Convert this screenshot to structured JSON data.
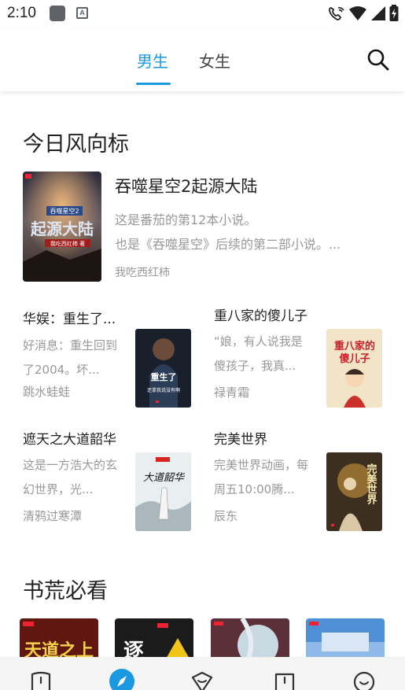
{
  "status": {
    "time": "2:10"
  },
  "tabs": {
    "male": "男生",
    "female": "女生"
  },
  "section1": {
    "title": "今日风向标"
  },
  "featured": {
    "title": "吞噬星空2起源大陆",
    "desc_line1": "这是番茄的第12本小说。",
    "desc_line2": "也是《吞噬星空》后续的第二部小说。...",
    "author": "我吃西红柿"
  },
  "books": [
    {
      "title": "华娱：重生了...",
      "desc": "好消息：重生回到了2004。坏...",
      "author": "跳水蛙蛙"
    },
    {
      "title": "重八家的傻儿子",
      "desc": "“娘，有人说我是傻孩子，我真...",
      "author": "禄青霜"
    },
    {
      "title": "遮天之大道韶华",
      "desc": "这是一方浩大的玄幻世界，光...",
      "author": "清鸦过寒潭"
    },
    {
      "title": "完美世界",
      "desc": "完美世界动画，每周五10:00腾...",
      "author": "辰东"
    }
  ],
  "section2": {
    "title": "书荒必看"
  },
  "colors": {
    "accent": "#1a98e0",
    "muted": "#999999"
  },
  "icons": [
    "search-icon",
    "bookshelf-icon",
    "discover-icon",
    "category-icon",
    "benefits-icon",
    "profile-icon"
  ]
}
